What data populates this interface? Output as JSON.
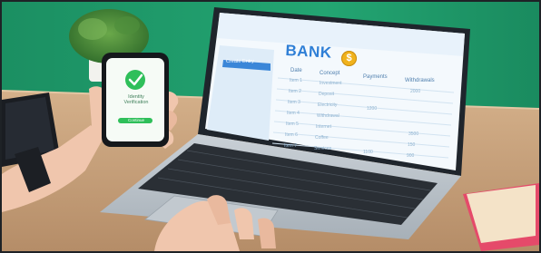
{
  "laptop_screen": {
    "brand_title": "BANK",
    "brand_icon": "dollar-coin-icon",
    "brand_icon_glyph": "$",
    "sidebar_button": "Create Entry",
    "table_headers": [
      "Date",
      "Concept",
      "Payments",
      "Withdrawals"
    ],
    "table_rows": [
      [
        "Item 1",
        "Investment",
        "",
        "2000"
      ],
      [
        "Item 2",
        "Deposit",
        "",
        ""
      ],
      [
        "Item 3",
        "Electricity",
        "1200",
        ""
      ],
      [
        "Item 4",
        "Withdrawal",
        "",
        ""
      ],
      [
        "Item 5",
        "Internet",
        "",
        "3500"
      ],
      [
        "Item 6",
        "Coffee",
        "",
        "150"
      ],
      [
        "Item 7",
        "Services",
        "",
        "900"
      ]
    ],
    "footer_value": "1100"
  },
  "phone_screen": {
    "status_icon": "checkmark-icon",
    "message": "Identity Verification",
    "button_label": "Continue"
  },
  "colors": {
    "wall": "#1f9a6a",
    "desk": "#c8a37e",
    "laptop_body": "#b9c2c9",
    "screen_accent": "#2f7fd6",
    "phone_check": "#2fbf5a"
  }
}
